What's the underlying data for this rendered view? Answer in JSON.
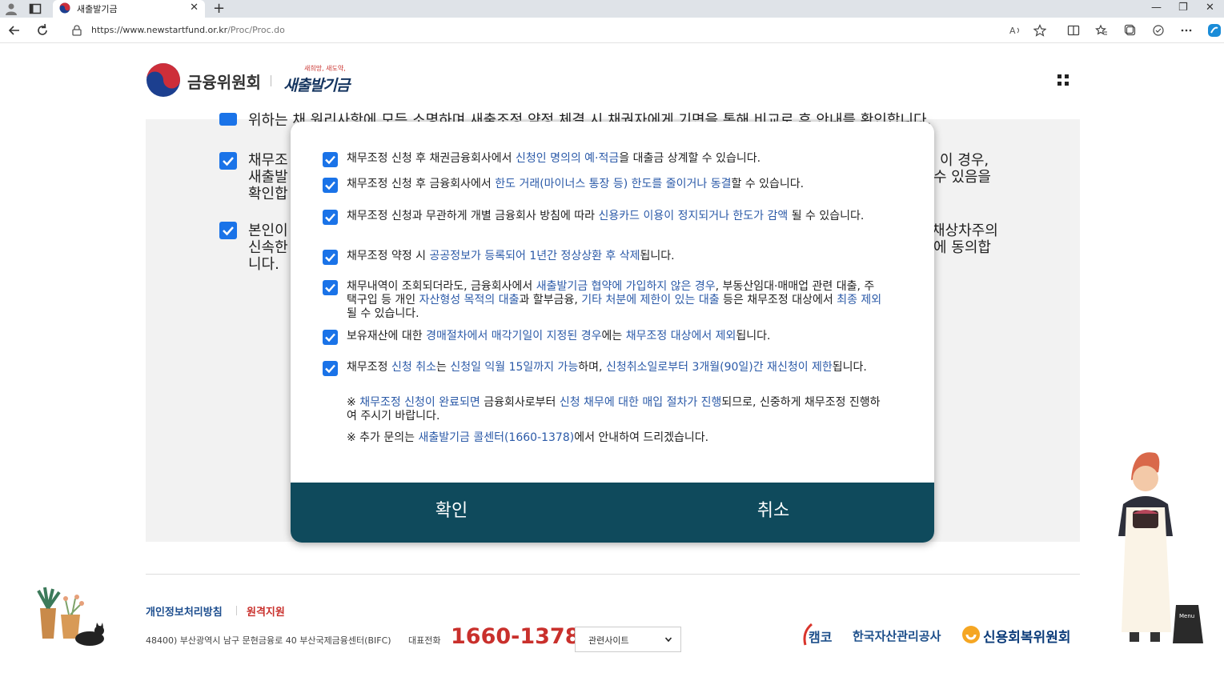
{
  "browser": {
    "tab_title": "새출발기금",
    "url_host": "https://www.newstartfund.or.kr",
    "url_path": "/Proc/Proc.do",
    "icons": [
      "profile-icon",
      "tabs-icon",
      "close-icon",
      "new-tab-icon",
      "back-icon",
      "reload-icon",
      "lock-icon",
      "read-aloud-icon",
      "favorite-icon",
      "split-icon",
      "favorites-icon",
      "collections-icon",
      "extensions-icon",
      "more-icon",
      "copilot-icon"
    ]
  },
  "header": {
    "fsc_name": "금융위원회",
    "nsf_tagline": "새희망, 새도약,",
    "nsf_name": "새출발기금",
    "menu_icon": "grid-menu-icon"
  },
  "background_items": [
    {
      "text": "위하는 채 원리사항에 모든 소명하며 새출조정 약정 체결 시 채권자에게 기면을 통해 비교로 후 안내를 확인합니다."
    },
    {
      "line1": "채무조",
      "line2": "새출발",
      "line3": "확인합",
      "right1": "이 경우,",
      "right2": "수 있음을"
    },
    {
      "line1": "본인이",
      "line2": "신속한",
      "line3": "니다.",
      "right1": "채상차주의",
      "right2": "에 동의합"
    }
  ],
  "modal": {
    "items": [
      {
        "parts": [
          [
            "채무조정 신청 후 채권금융회사에서 ",
            false
          ],
          [
            "신청인 명의의 예·적금",
            true
          ],
          [
            "을 대출금 상계할 수 있습니다.",
            false
          ]
        ]
      },
      {
        "parts": [
          [
            "채무조정 신청 후 금융회사에서 ",
            false
          ],
          [
            "한도 거래(마이너스 통장 등) 한도를 줄이거나 동결",
            true
          ],
          [
            "할 수 있습니다.",
            false
          ]
        ]
      },
      {
        "parts": [
          [
            "채무조정 신청과 무관하게 개별 금융회사 방침에 따라 ",
            false
          ],
          [
            "신용카드 이용이 정지되거나 한도가 감액",
            true
          ],
          [
            " 될 수 있습니다.",
            false
          ]
        ]
      },
      {
        "parts": [
          [
            "채무조정 약정 시 ",
            false
          ],
          [
            "공공정보가 등록되어 1년간 정상상환 후 삭제",
            true
          ],
          [
            "됩니다.",
            false
          ]
        ]
      },
      {
        "parts": [
          [
            "채무내역이 조회되더라도, 금융회사에서 ",
            false
          ],
          [
            "새출발기금 협약에 가입하지 않은 경우",
            true
          ],
          [
            ", 부동산임대·매매업 관련 대출, 주택구입 등 개인 ",
            false
          ],
          [
            "자산형성 목적의 대출",
            true
          ],
          [
            "과 할부금융, ",
            false
          ],
          [
            "기타 처분에 제한이 있는 대출",
            true
          ],
          [
            " 등은 채무조정 대상에서 ",
            false
          ],
          [
            "최종 제외",
            true
          ],
          [
            "될 수 있습니다.",
            false
          ]
        ]
      },
      {
        "parts": [
          [
            "보유재산에 대한 ",
            false
          ],
          [
            "경매절차에서 매각기일이 지정된 경우",
            true
          ],
          [
            "에는 ",
            false
          ],
          [
            "채무조정 대상에서 제외",
            true
          ],
          [
            "됩니다.",
            false
          ]
        ]
      },
      {
        "parts": [
          [
            "채무조정 ",
            false
          ],
          [
            "신청 취소",
            true
          ],
          [
            "는 ",
            false
          ],
          [
            "신청일 익월 15일까지 가능",
            true
          ],
          [
            "하며, ",
            false
          ],
          [
            "신청취소일로부터 3개월(90일)간 재신청이 제한",
            true
          ],
          [
            "됩니다.",
            false
          ]
        ]
      }
    ],
    "notes": [
      {
        "parts": [
          [
            "※ ",
            false
          ],
          [
            "채무조정 신청이 완료되면",
            true
          ],
          [
            " 금융회사로부터 ",
            false
          ],
          [
            "신청 채무에 대한 매입 절차가 진행",
            true
          ],
          [
            "되므로, 신중하게 채무조정 진행하여 주시기 바랍니다.",
            false
          ]
        ]
      },
      {
        "parts": [
          [
            "※ 추가 문의는 ",
            false
          ],
          [
            "새출발기금 콜센터(1660-1378)",
            true
          ],
          [
            "에서 안내하여 드리겠습니다.",
            false
          ]
        ]
      }
    ],
    "confirm_label": "확인",
    "cancel_label": "취소"
  },
  "footer": {
    "privacy_label": "개인정보처리방침",
    "remote_label": "원격지원",
    "address": "48400) 부산광역시 남구 문현금융로 40 부산국제금융센터(BIFC)",
    "phone_label": "대표전화",
    "phone": "1660-1378",
    "related_select": "관련사이트",
    "kamco_mark": "캠코",
    "kamco_name": "한국자산관리공사",
    "ccrs_name": "신용회복위원회"
  },
  "colors": {
    "accent_blue": "#2b5aa8",
    "checkbox": "#1a73e8",
    "modal_footer": "#0f4a5c",
    "phone_red": "#c9302c",
    "remote_red": "#c9302c",
    "privacy_blue": "#1d4e8f"
  }
}
